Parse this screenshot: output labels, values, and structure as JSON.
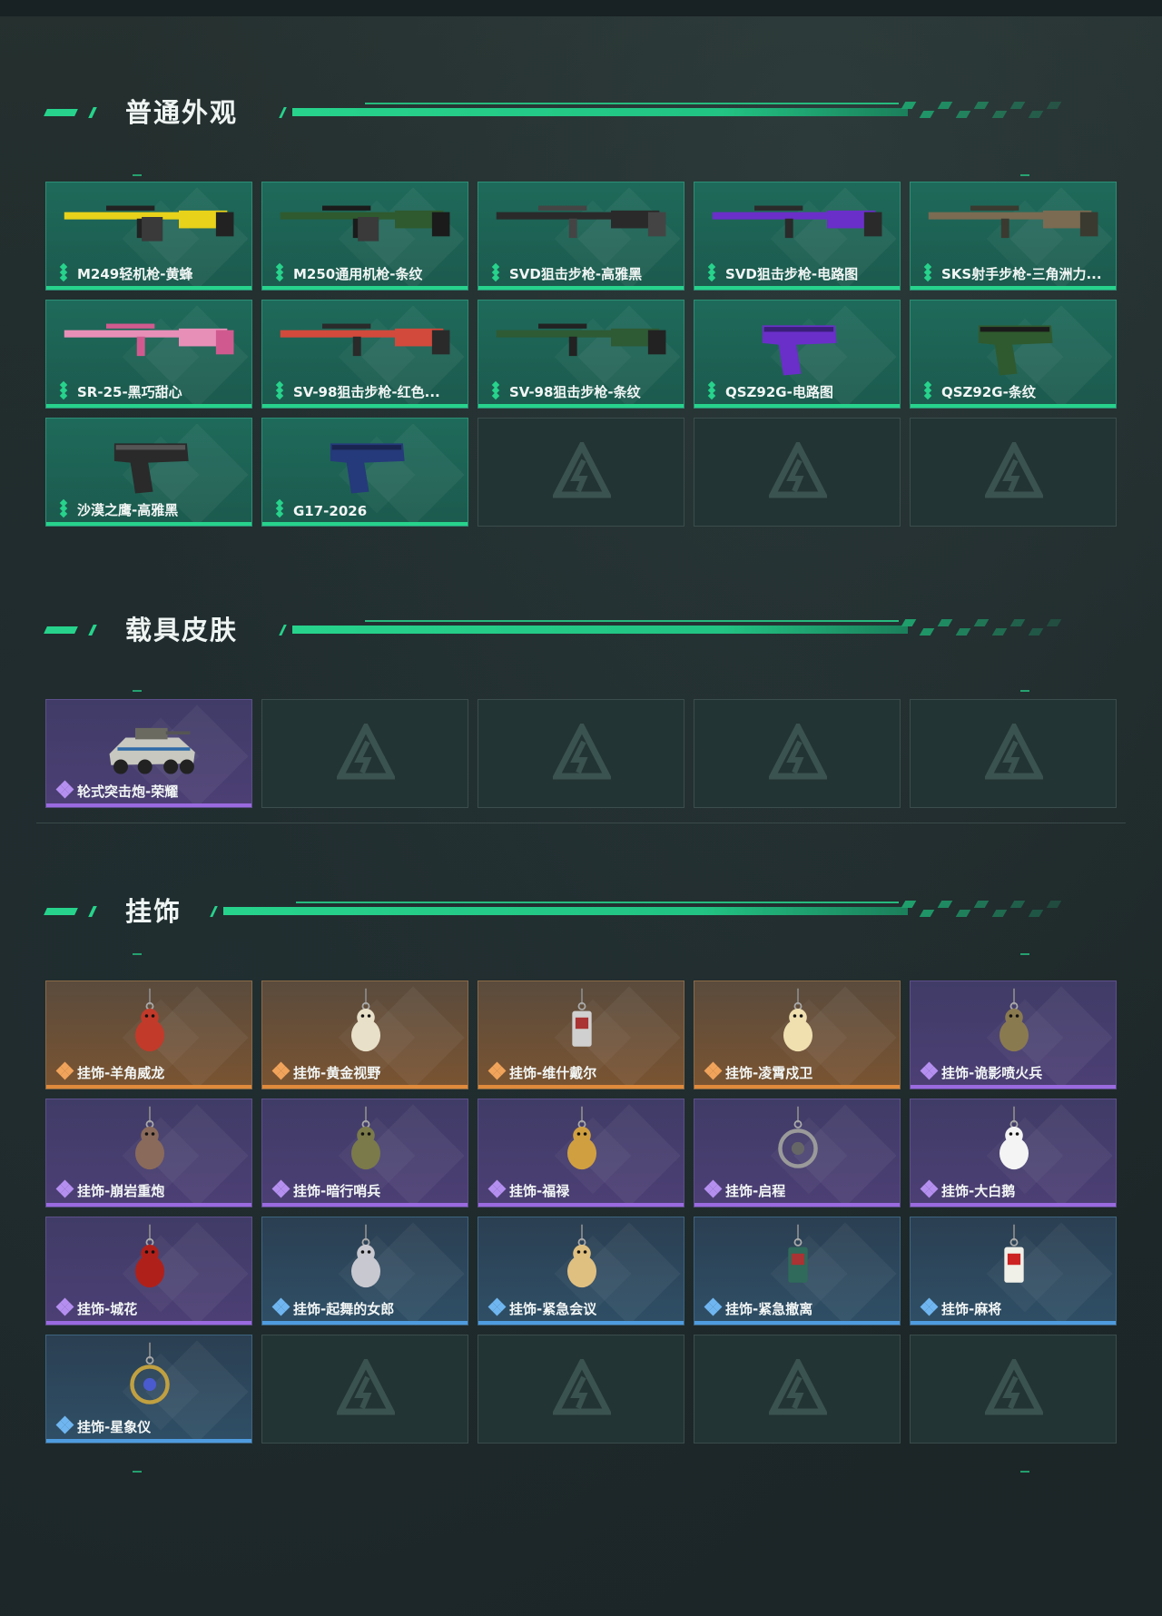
{
  "sections": [
    {
      "title": "普通外观",
      "items": [
        {
          "label": "M249轻机枪-黄蜂",
          "rarity": "green",
          "icon": "machine-gun-yellow"
        },
        {
          "label": "M250通用机枪-条纹",
          "rarity": "green",
          "icon": "machine-gun-green-camo"
        },
        {
          "label": "SVD狙击步枪-高雅黑",
          "rarity": "green",
          "icon": "sniper-rifle-black"
        },
        {
          "label": "SVD狙击步枪-电路图",
          "rarity": "green",
          "icon": "sniper-rifle-purple"
        },
        {
          "label": "SKS射手步枪-三角洲力...",
          "rarity": "green",
          "icon": "rifle-camo"
        },
        {
          "label": "SR-25-黑巧甜心",
          "rarity": "green",
          "icon": "rifle-pink"
        },
        {
          "label": "SV-98狙击步枪-红色...",
          "rarity": "green",
          "icon": "sniper-rifle-red"
        },
        {
          "label": "SV-98狙击步枪-条纹",
          "rarity": "green",
          "icon": "sniper-rifle-green"
        },
        {
          "label": "QSZ92G-电路图",
          "rarity": "green",
          "icon": "pistol-purple"
        },
        {
          "label": "QSZ92G-条纹",
          "rarity": "green",
          "icon": "pistol-green"
        },
        {
          "label": "沙漠之鹰-高雅黑",
          "rarity": "green",
          "icon": "pistol-black"
        },
        {
          "label": "G17-2026",
          "rarity": "green",
          "icon": "pistol-blue"
        }
      ],
      "empty": 3
    },
    {
      "title": "载具皮肤",
      "items": [
        {
          "label": "轮式突击炮-荣耀",
          "rarity": "purple",
          "icon": "armored-vehicle"
        }
      ],
      "empty": 4
    },
    {
      "title": "挂饰",
      "items": [
        {
          "label": "挂饰-羊角威龙",
          "rarity": "orange",
          "icon": "charm-red-figure"
        },
        {
          "label": "挂饰-黄金视野",
          "rarity": "orange",
          "icon": "charm-white-figure"
        },
        {
          "label": "挂饰-维什戴尔",
          "rarity": "orange",
          "icon": "charm-tag"
        },
        {
          "label": "挂饰-凌霄戍卫",
          "rarity": "orange",
          "icon": "charm-duck"
        },
        {
          "label": "挂饰-诡影喷火兵",
          "rarity": "purple",
          "icon": "charm-soldier"
        },
        {
          "label": "挂饰-崩岩重炮",
          "rarity": "purple",
          "icon": "charm-heavy"
        },
        {
          "label": "挂饰-暗行哨兵",
          "rarity": "purple",
          "icon": "charm-sentinel"
        },
        {
          "label": "挂饰-福禄",
          "rarity": "purple",
          "icon": "charm-gourd"
        },
        {
          "label": "挂饰-启程",
          "rarity": "purple",
          "icon": "charm-ring"
        },
        {
          "label": "挂饰-大白鹅",
          "rarity": "purple",
          "icon": "charm-goose"
        },
        {
          "label": "挂饰-城花",
          "rarity": "purple",
          "icon": "charm-rose"
        },
        {
          "label": "挂饰-起舞的女郎",
          "rarity": "blue",
          "icon": "charm-dancer"
        },
        {
          "label": "挂饰-紧急会议",
          "rarity": "blue",
          "icon": "charm-meeting"
        },
        {
          "label": "挂饰-紧急撤离",
          "rarity": "blue",
          "icon": "charm-evac"
        },
        {
          "label": "挂饰-麻将",
          "rarity": "blue",
          "icon": "charm-mahjong"
        },
        {
          "label": "挂饰-星象仪",
          "rarity": "blue",
          "icon": "charm-astrolabe"
        }
      ],
      "empty": 4
    }
  ],
  "colors": {
    "accent": "#27d38c",
    "green": "#1e6a5a",
    "purple": "#4c3f74",
    "orange": "#7a5431",
    "blue": "#2f4f66"
  }
}
